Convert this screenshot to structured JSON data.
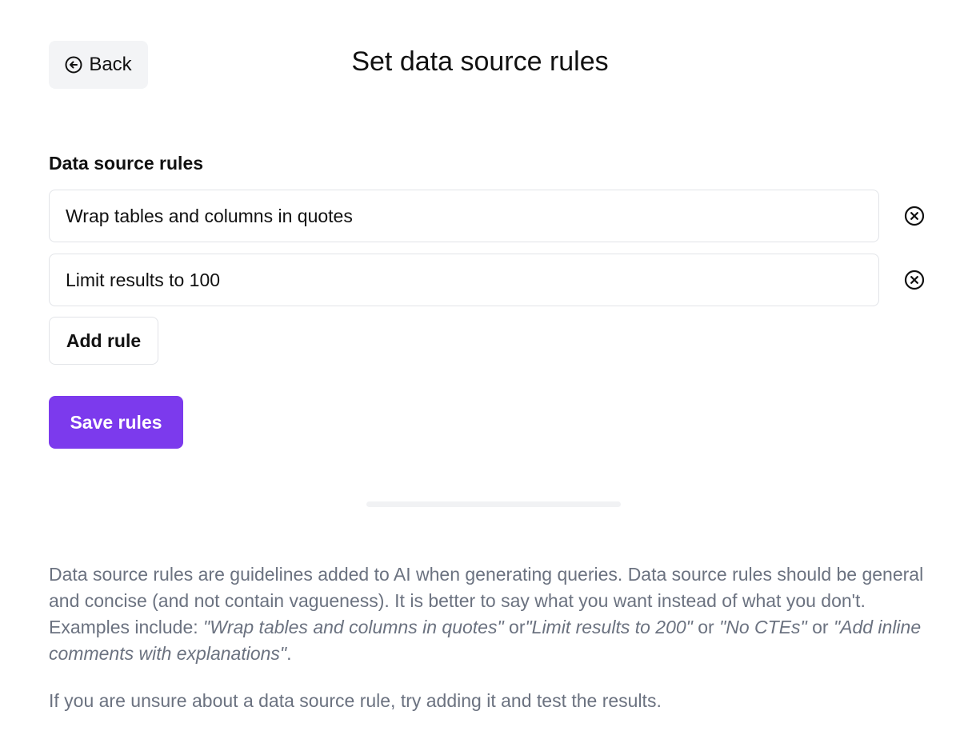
{
  "header": {
    "back_label": "Back",
    "title": "Set data source rules"
  },
  "rules_section": {
    "label": "Data source rules",
    "rules": [
      {
        "value": "Wrap tables and columns in quotes"
      },
      {
        "value": "Limit results to 100"
      }
    ],
    "add_rule_label": "Add rule",
    "save_label": "Save rules"
  },
  "help": {
    "intro": "Data source rules are guidelines added to AI when generating queries. Data source rules should be general and concise (and not contain vagueness). It is better to say what you want instead of what you don't. Examples include: ",
    "examples": [
      "\"Wrap tables and columns in quotes\"",
      "\"Limit results to 200\"",
      "\"No CTEs\"",
      "\"Add inline comments with explanations\""
    ],
    "sep_or": "or",
    "period": ".",
    "note": "If you are unsure about a data source rule, try adding it and test the results."
  },
  "colors": {
    "accent": "#7c3aed",
    "muted_text": "#6b7280",
    "border": "#e2e4e8",
    "back_bg": "#f3f4f6"
  },
  "icons": {
    "back": "circle-arrow-left-icon",
    "remove": "circle-x-icon"
  }
}
